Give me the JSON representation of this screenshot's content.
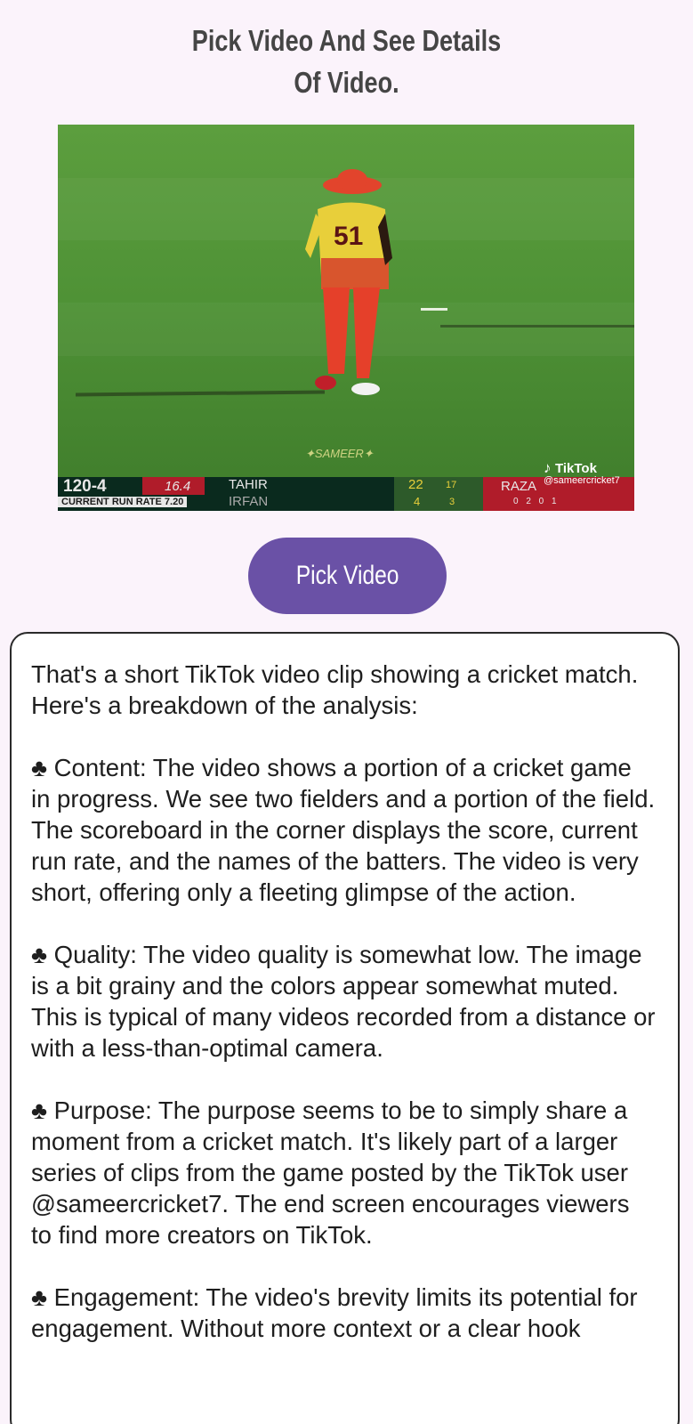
{
  "header": {
    "title_line1": "Pick Video And See Details",
    "title_line2": "Of Video."
  },
  "video_preview": {
    "watermark": "✦SAMEER✦",
    "scoreboard": {
      "score": "120-4",
      "overs": "16.4",
      "run_rate": "CURRENT RUN RATE 7.20",
      "batter1": "TAHIR",
      "batter2": "IRFAN",
      "stat1": "22",
      "stat1b": "17",
      "stat2": "4",
      "stat2b": "3",
      "bowler": "RAZA",
      "bowler_figures": "0 2 0 1"
    },
    "platform": "TikTok",
    "handle": "@sameercricket7",
    "player_number": "51"
  },
  "actions": {
    "pick_video_label": "Pick Video"
  },
  "result": {
    "text": "That's a short TikTok video clip showing a cricket match. Here's a breakdown of the analysis:\n\n♣ Content: The video shows a portion of a cricket game in progress. We see two fielders and a portion of the field. The scoreboard in the corner displays the score, current run rate, and the names of the batters. The video is very short, offering only a fleeting glimpse of the action.\n\n♣ Quality: The video quality is somewhat low. The image is a bit grainy and the colors appear somewhat muted. This is typical of many videos recorded from a distance or with a less-than-optimal camera.\n\n♣ Purpose: The purpose seems to be to simply share a moment from a cricket match. It's likely part of a larger series of clips from the game posted by the TikTok user @sameercricket7. The end screen encourages viewers to find more creators on TikTok.\n\n♣ Engagement: The video's brevity limits its potential for engagement. Without more context or a clear hook"
  },
  "colors": {
    "background": "#fbf3fb",
    "button": "#6a51a6",
    "title_text": "#454545",
    "body_text": "#1e1e1e"
  }
}
